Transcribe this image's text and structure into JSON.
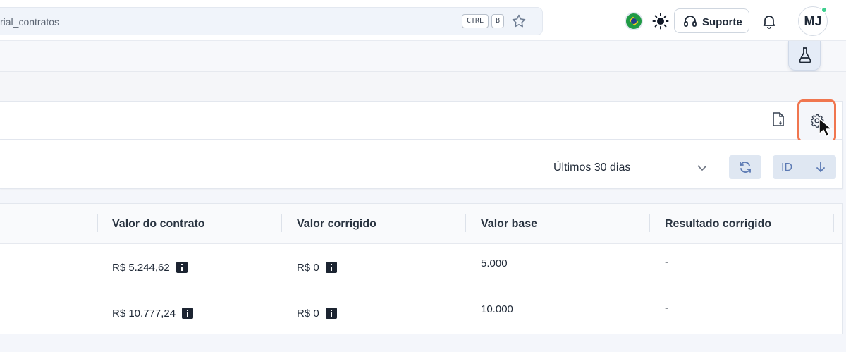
{
  "topbar": {
    "search_text": "rial_contratos",
    "shortcut_ctrl": "CTRL",
    "shortcut_key": "B",
    "support_label": "Suporte",
    "avatar_initials": "MJ"
  },
  "icons": {
    "favorite": "star-icon",
    "language": "brazil-flag-icon",
    "theme": "sun-icon",
    "support": "headset-icon",
    "notifications": "bell-icon",
    "labs": "flask-icon",
    "export": "file-export-icon",
    "settings": "gear-icon",
    "refresh": "refresh-icon",
    "sort": "arrow-down-icon",
    "dropdown": "chevron-down-icon",
    "info": "info-icon"
  },
  "colors": {
    "highlight": "#f0764f",
    "button_bg": "#dfe7f2",
    "button_fg": "#5b79b3",
    "online_status": "#3ecf8e"
  },
  "filters": {
    "period_value": "Últimos 30 dias",
    "sort_field": "ID"
  },
  "table": {
    "columns": [
      "Valor do contrato",
      "Valor corrigido",
      "Valor base",
      "Resultado corrigido"
    ],
    "rows": [
      {
        "valor_contrato": "R$ 5.244,62",
        "valor_corrigido": "R$ 0",
        "valor_base": "5.000",
        "resultado_corrigido": "-"
      },
      {
        "valor_contrato": "R$ 10.777,24",
        "valor_corrigido": "R$ 0",
        "valor_base": "10.000",
        "resultado_corrigido": "-"
      }
    ]
  }
}
